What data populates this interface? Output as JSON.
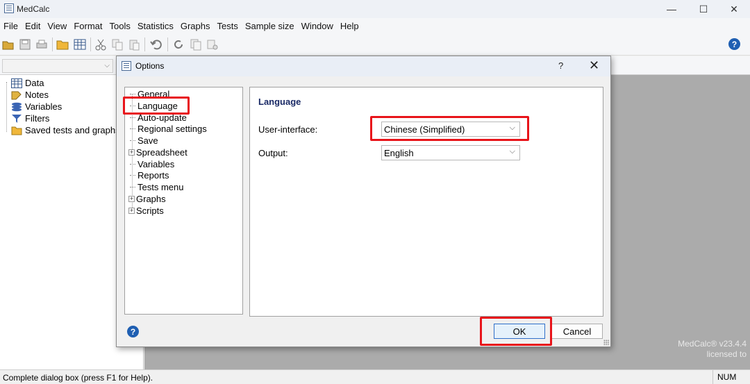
{
  "app": {
    "title": "MedCalc"
  },
  "window_controls": {
    "minimize": "—",
    "maximize": "☐",
    "close": "✕"
  },
  "menu": [
    "File",
    "Edit",
    "View",
    "Format",
    "Tools",
    "Statistics",
    "Graphs",
    "Tests",
    "Sample size",
    "Window",
    "Help"
  ],
  "toolbar": {
    "icons": [
      "open-icon",
      "save-icon",
      "print-icon",
      "open-folder-icon",
      "spreadsheet-icon",
      "cut-icon",
      "copy-icon",
      "paste-icon",
      "undo-icon",
      "refresh-icon",
      "copy-page-icon",
      "paste-special-icon"
    ],
    "help": "?"
  },
  "left_tree": {
    "items": [
      {
        "label": "Data",
        "icon": "data-grid-icon"
      },
      {
        "label": "Notes",
        "icon": "notes-icon"
      },
      {
        "label": "Variables",
        "icon": "variables-icon"
      },
      {
        "label": "Filters",
        "icon": "filter-icon"
      },
      {
        "label": "Saved tests and graphs",
        "icon": "folder-icon"
      }
    ]
  },
  "dialog": {
    "title": "Options",
    "help_btn": "?",
    "close_btn": "✕",
    "tree": [
      {
        "label": "General",
        "expandable": false
      },
      {
        "label": "Language",
        "expandable": false,
        "selected": true
      },
      {
        "label": "Auto-update",
        "expandable": false
      },
      {
        "label": "Regional settings",
        "expandable": false
      },
      {
        "label": "Save",
        "expandable": false
      },
      {
        "label": "Spreadsheet",
        "expandable": true
      },
      {
        "label": "Variables",
        "expandable": false
      },
      {
        "label": "Reports",
        "expandable": false
      },
      {
        "label": "Tests menu",
        "expandable": false
      },
      {
        "label": "Graphs",
        "expandable": true
      },
      {
        "label": "Scripts",
        "expandable": true
      }
    ],
    "expand_glyph": "+",
    "panel": {
      "header": "Language",
      "ui_label": "User-interface:",
      "ui_value": "Chinese (Simplified)",
      "output_label": "Output:",
      "output_value": "English",
      "dropdown_glyph": "⌵"
    },
    "ok": "OK",
    "cancel": "Cancel",
    "help_glyph": "?"
  },
  "brand": {
    "line1": "MedCalc® v23.4.4",
    "line2": "licensed to"
  },
  "status": {
    "text": "Complete dialog box (press F1 for Help).",
    "num": "NUM"
  },
  "colors": {
    "highlight": "#e8141a",
    "accent": "#1f5fb2",
    "workarea": "#ababab"
  }
}
